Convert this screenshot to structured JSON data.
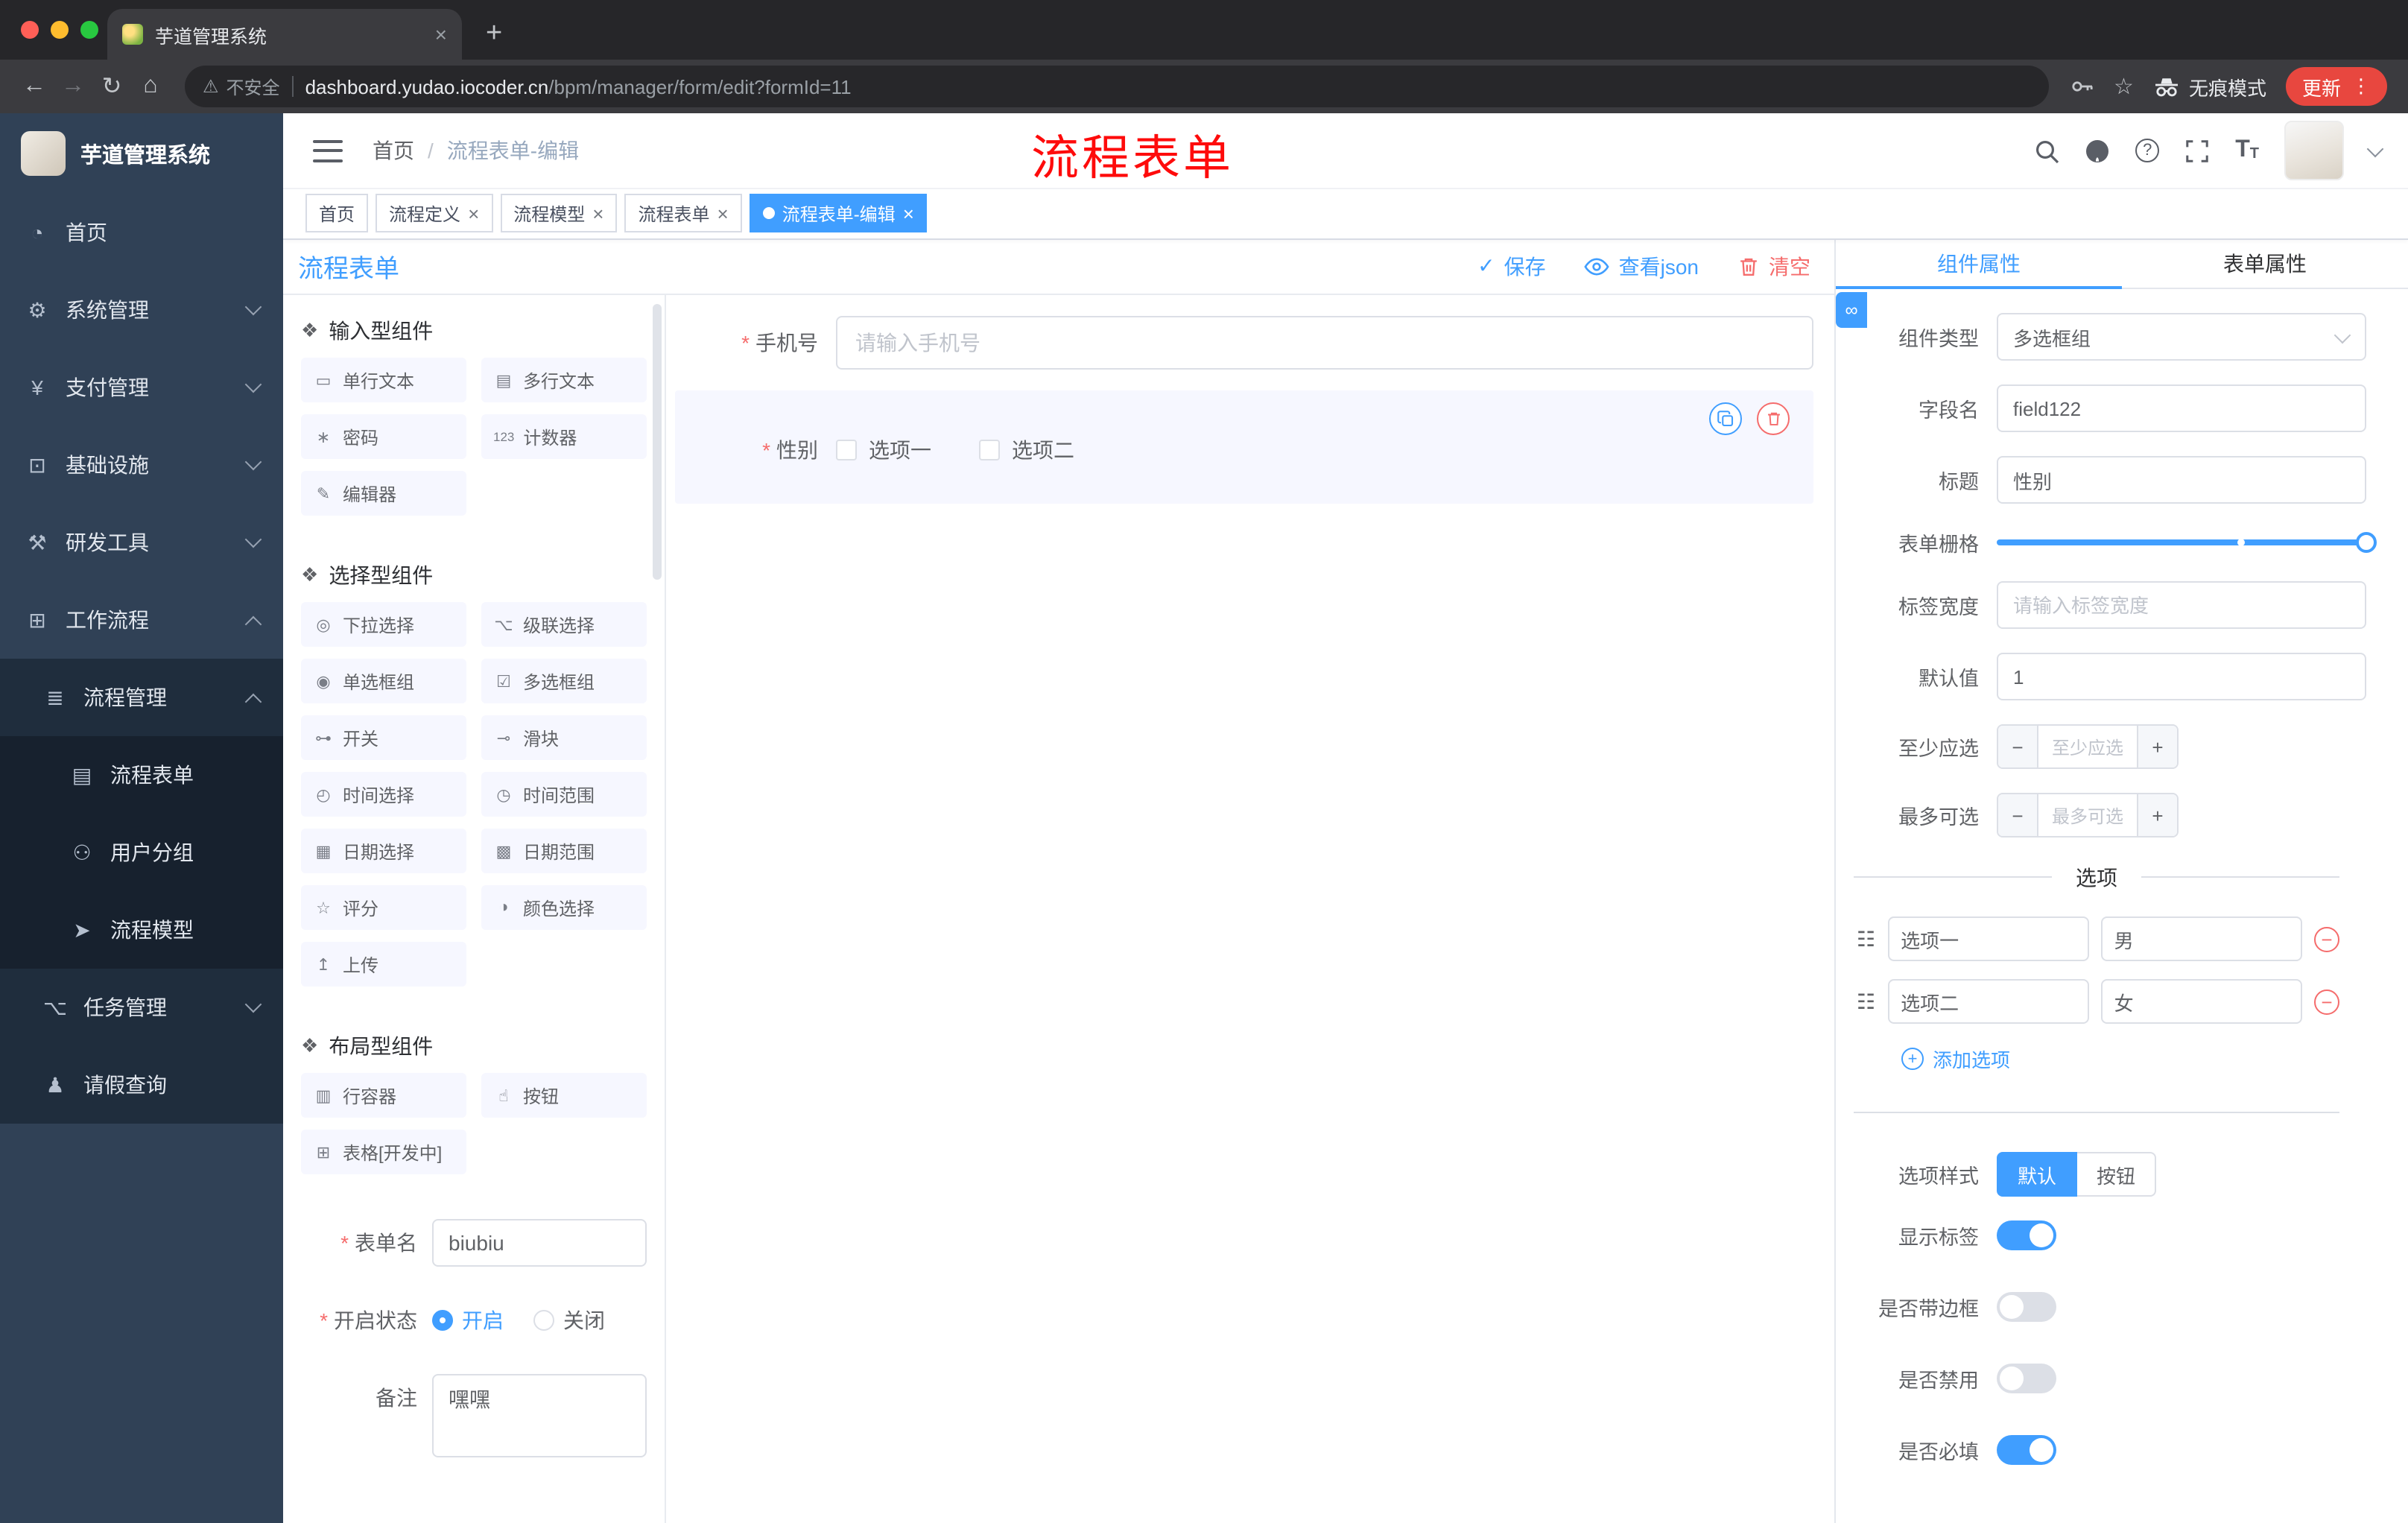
{
  "browser": {
    "tab_title": "芋道管理系统",
    "security_label": "不安全",
    "url_host": "dashboard.yudao.iocoder.cn",
    "url_path": "/bpm/manager/form/edit?formId=11",
    "incognito_label": "无痕模式",
    "update_label": "更新"
  },
  "icons": {
    "close": "×",
    "new_tab": "+",
    "back": "←",
    "forward": "→",
    "reload": "↻",
    "home": "⌂",
    "warning": "⚠",
    "star": "☆",
    "menu_dots": "⋮",
    "check": "✓",
    "question": "?",
    "section": "❖",
    "drag_handle": "☷",
    "minus": "−",
    "plus": "+",
    "link": "∞",
    "font_big": "T",
    "font_small": "T"
  },
  "sidebar": {
    "logo_title": "芋道管理系统",
    "menu": [
      {
        "glyph": "◔",
        "label": "首页"
      },
      {
        "glyph": "⚙",
        "label": "系统管理"
      },
      {
        "glyph": "¥",
        "label": "支付管理"
      },
      {
        "glyph": "⊡",
        "label": "基础设施"
      },
      {
        "glyph": "⚒",
        "label": "研发工具"
      },
      {
        "glyph": "⊞",
        "label": "工作流程"
      },
      {
        "glyph": "≣",
        "label": "流程管理"
      },
      {
        "glyph": "▤",
        "label": "流程表单"
      },
      {
        "glyph": "⚇",
        "label": "用户分组"
      },
      {
        "glyph": "➤",
        "label": "流程模型"
      },
      {
        "glyph": "⌥",
        "label": "任务管理"
      },
      {
        "glyph": "♟",
        "label": "请假查询"
      }
    ]
  },
  "header": {
    "breadcrumb_home": "首页",
    "breadcrumb_sep": "/",
    "breadcrumb_current": "流程表单-编辑",
    "annotation": "流程表单"
  },
  "tags": [
    {
      "label": "首页"
    },
    {
      "label": "流程定义"
    },
    {
      "label": "流程模型"
    },
    {
      "label": "流程表单"
    },
    {
      "label": "流程表单-编辑"
    }
  ],
  "designer": {
    "title": "流程表单",
    "save": "保存",
    "view_json": "查看json",
    "clear": "清空"
  },
  "palette": {
    "sections": [
      {
        "title": "输入型组件",
        "items": [
          {
            "icon": "▭",
            "label": "单行文本"
          },
          {
            "icon": "▤",
            "label": "多行文本"
          },
          {
            "icon": "∗",
            "label": "密码"
          },
          {
            "icon": "123",
            "label": "计数器"
          },
          {
            "icon": "✎",
            "label": "编辑器"
          }
        ]
      },
      {
        "title": "选择型组件",
        "items": [
          {
            "icon": "◎",
            "label": "下拉选择"
          },
          {
            "icon": "⌥",
            "label": "级联选择"
          },
          {
            "icon": "◉",
            "label": "单选框组"
          },
          {
            "icon": "☑",
            "label": "多选框组"
          },
          {
            "icon": "⊶",
            "label": "开关"
          },
          {
            "icon": "⊸",
            "label": "滑块"
          },
          {
            "icon": "◴",
            "label": "时间选择"
          },
          {
            "icon": "◷",
            "label": "时间范围"
          },
          {
            "icon": "▦",
            "label": "日期选择"
          },
          {
            "icon": "▩",
            "label": "日期范围"
          },
          {
            "icon": "☆",
            "label": "评分"
          },
          {
            "icon": "◑",
            "label": "颜色选择"
          },
          {
            "icon": "↥",
            "label": "上传"
          }
        ]
      },
      {
        "title": "布局型组件",
        "items": [
          {
            "icon": "▥",
            "label": "行容器"
          },
          {
            "icon": "☝",
            "label": "按钮"
          },
          {
            "icon": "⊞",
            "label": "表格[开发中]"
          }
        ]
      }
    ],
    "form": {
      "name_label": "表单名",
      "name_value": "biubiu",
      "status_label": "开启状态",
      "status_on": "开启",
      "status_off": "关闭",
      "remark_label": "备注",
      "remark_value": "嘿嘿"
    }
  },
  "canvas": {
    "phone_label": "手机号",
    "phone_placeholder": "请输入手机号",
    "gender_label": "性别",
    "gender_options": [
      "选项一",
      "选项二"
    ]
  },
  "props": {
    "tab_component": "组件属性",
    "tab_form": "表单属性",
    "type_label": "组件类型",
    "type_value": "多选框组",
    "field_label": "字段名",
    "field_value": "field122",
    "title_label": "标题",
    "title_value": "性别",
    "grid_label": "表单栅格",
    "width_label": "标签宽度",
    "width_placeholder": "请输入标签宽度",
    "default_label": "默认值",
    "default_value": "1",
    "min_label": "至少应选",
    "min_placeholder": "至少应选",
    "max_label": "最多可选",
    "max_placeholder": "最多可选",
    "options_title": "选项",
    "options": [
      {
        "name": "选项一",
        "value": "男"
      },
      {
        "name": "选项二",
        "value": "女"
      }
    ],
    "add_option": "添加选项",
    "style_label": "选项样式",
    "style_default": "默认",
    "style_button": "按钮",
    "toggle_show_label": "显示标签",
    "toggle_border": "是否带边框",
    "toggle_disabled": "是否禁用",
    "toggle_required": "是否必填"
  },
  "colors": {
    "accent": "#409eff",
    "danger": "#f56c6c",
    "sidebar_bg": "#304156",
    "update_pill": "#e8473f",
    "annotation_red": "#fe0b0b"
  }
}
